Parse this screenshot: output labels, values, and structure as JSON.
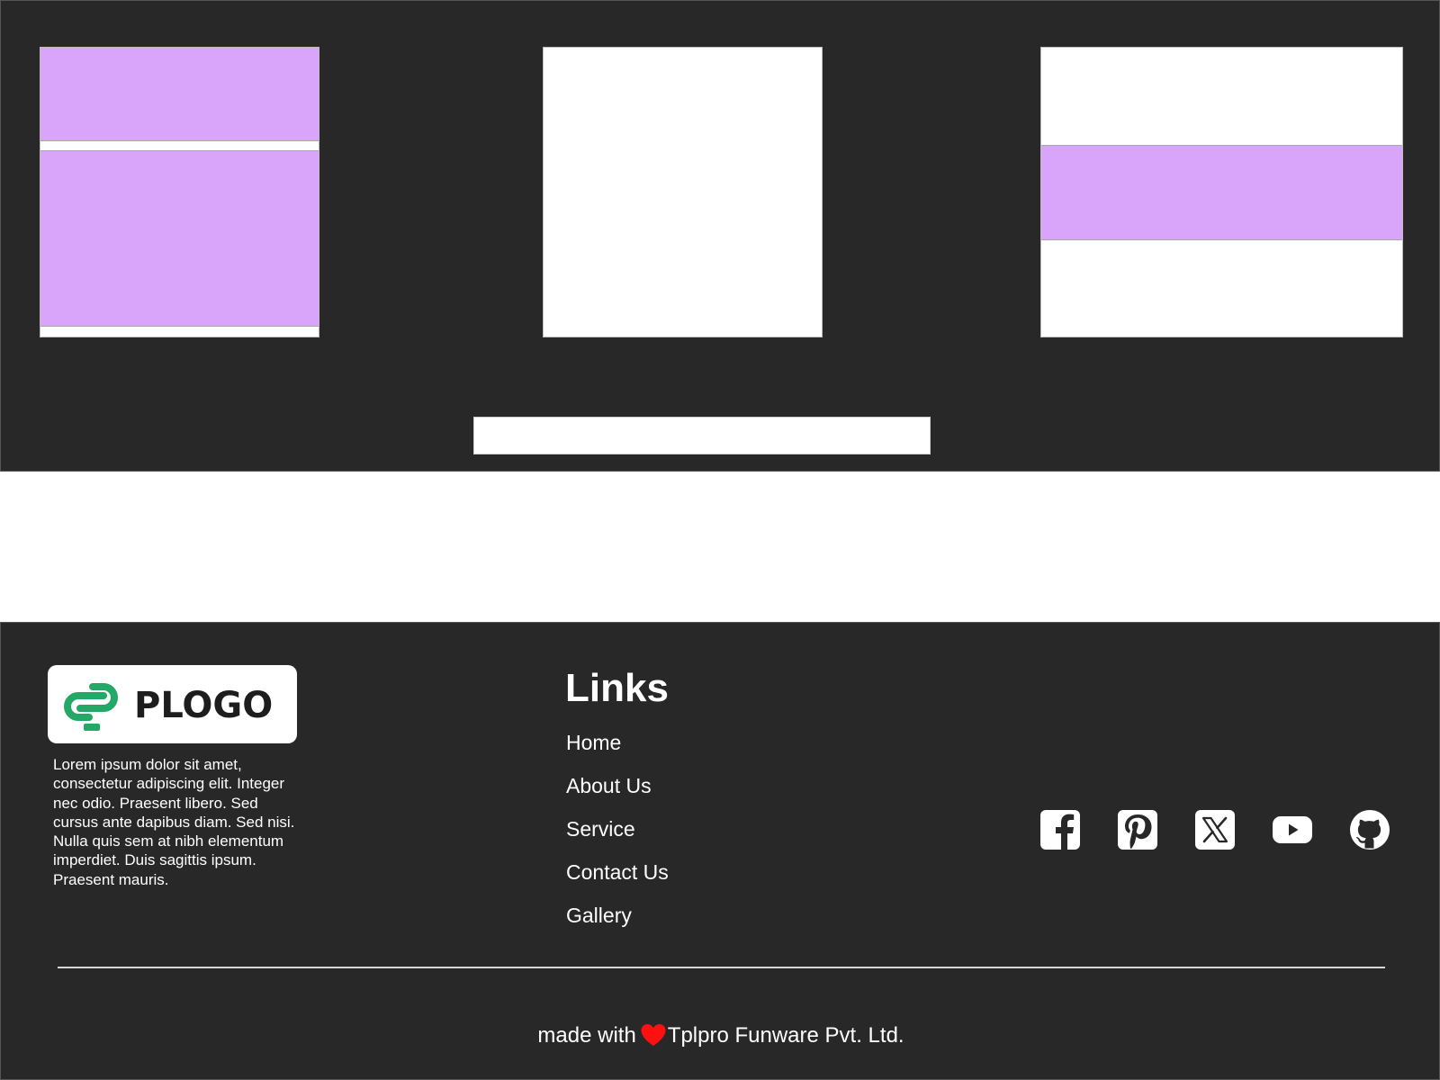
{
  "footer": {
    "logo": {
      "text": "PLOGO",
      "mark_color": "#23a866"
    },
    "about_text": "Lorem ipsum dolor sit amet, consectetur adipiscing elit. Integer nec odio. Praesent libero. Sed cursus ante dapibus diam. Sed nisi. Nulla quis sem at nibh elementum imperdiet. Duis sagittis ipsum. Praesent mauris.",
    "links_title": "Links",
    "links": [
      {
        "label": "Home"
      },
      {
        "label": "About Us"
      },
      {
        "label": "Service"
      },
      {
        "label": "Contact Us"
      },
      {
        "label": "Gallery"
      }
    ],
    "socials": [
      {
        "icon": "facebook-icon"
      },
      {
        "icon": "pinterest-icon"
      },
      {
        "icon": "x-icon"
      },
      {
        "icon": "youtube-icon"
      },
      {
        "icon": "github-icon"
      }
    ],
    "credit": {
      "prefix": "made with",
      "heart_icon": "heart-icon",
      "company": "Tplpro Funware Pvt. Ltd."
    }
  },
  "colors": {
    "dark_background": "#282828",
    "placeholder_purple": "#d9a5fb",
    "heart_red": "#ff1010",
    "text": "#ffffff"
  }
}
